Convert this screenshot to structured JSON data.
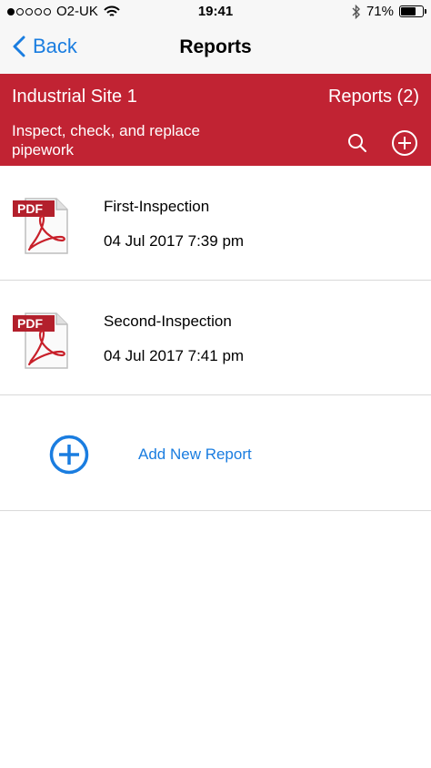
{
  "status": {
    "carrier": "O2-UK",
    "time": "19:41",
    "battery": "71%",
    "battery_level": 0.71
  },
  "nav": {
    "back_label": "Back",
    "title": "Reports"
  },
  "site": {
    "name": "Industrial Site 1",
    "reports_count": "Reports (2)",
    "description": "Inspect, check, and replace pipework"
  },
  "reports": [
    {
      "name": "First-Inspection",
      "date": "04 Jul 2017 7:39 pm",
      "icon": "pdf-file-icon"
    },
    {
      "name": "Second-Inspection",
      "date": "04 Jul 2017 7:41 pm",
      "icon": "pdf-file-icon"
    }
  ],
  "add_report": {
    "label": "Add New Report"
  },
  "colors": {
    "accent": "#1a7de0",
    "header_red": "#c12333"
  }
}
